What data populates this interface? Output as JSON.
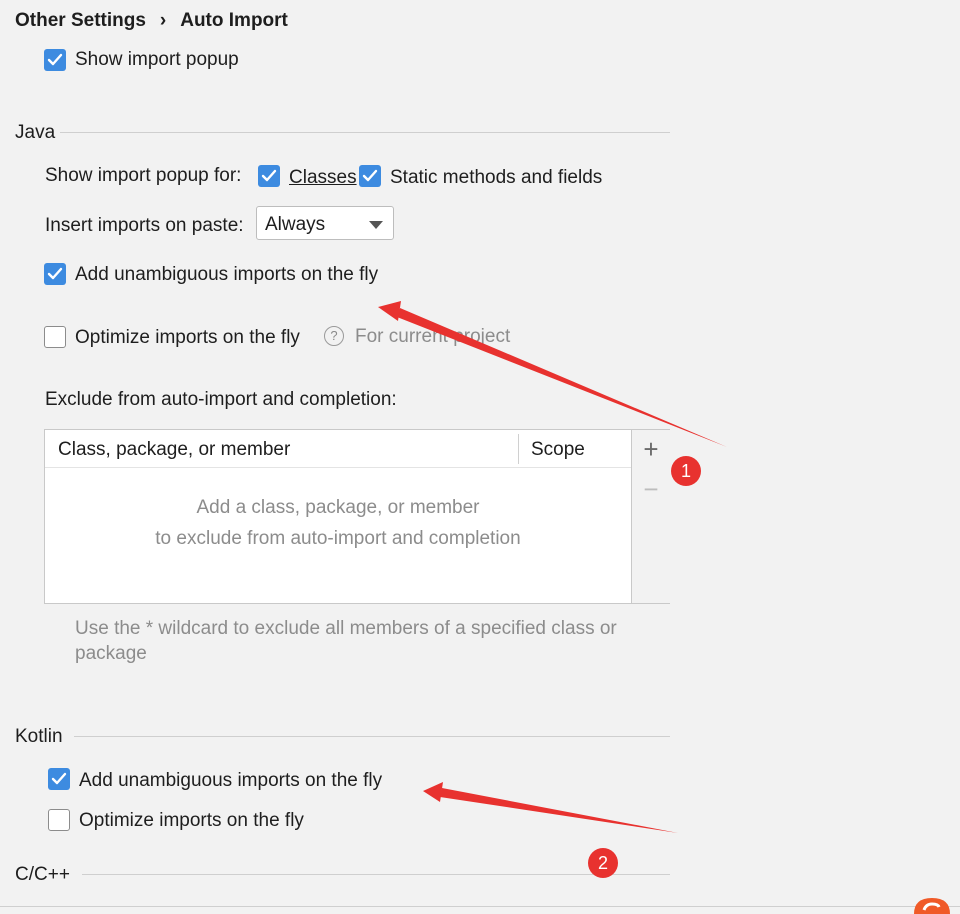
{
  "breadcrumb": {
    "parent": "Other Settings",
    "separator": "›",
    "current": "Auto Import"
  },
  "general": {
    "show_import_popup": {
      "label": "Show import popup",
      "checked": true
    }
  },
  "java": {
    "section_title": "Java",
    "show_popup_for_label": "Show import popup for:",
    "classes": {
      "label": "Classes",
      "checked": true
    },
    "static_members": {
      "label": "Static methods and fields",
      "checked": true
    },
    "insert_on_paste_label": "Insert imports on paste:",
    "insert_on_paste_value": "Always",
    "add_unambiguous": {
      "label": "Add unambiguous imports on the fly",
      "checked": true
    },
    "optimize": {
      "label": "Optimize imports on the fly",
      "checked": false
    },
    "help_glyph": "?",
    "for_current_project": "For current project",
    "exclude_label": "Exclude from auto-import and completion:",
    "table": {
      "columns": [
        "Class, package, or member",
        "Scope"
      ],
      "empty_line1": "Add a class, package, or member",
      "empty_line2": "to exclude from auto-import and completion",
      "add_glyph": "+",
      "remove_glyph": "−"
    },
    "hint": "Use the * wildcard to exclude all members of a specified class or package"
  },
  "kotlin": {
    "section_title": "Kotlin",
    "add_unambiguous": {
      "label": "Add unambiguous imports on the fly",
      "checked": true
    },
    "optimize": {
      "label": "Optimize imports on the fly",
      "checked": false
    }
  },
  "cpp": {
    "section_title": "C/C++"
  },
  "annotations": {
    "badge1": "1",
    "badge2": "2",
    "color": "#e8322f"
  },
  "colors": {
    "accent": "#3d8be0",
    "background": "#f2f2f2"
  }
}
